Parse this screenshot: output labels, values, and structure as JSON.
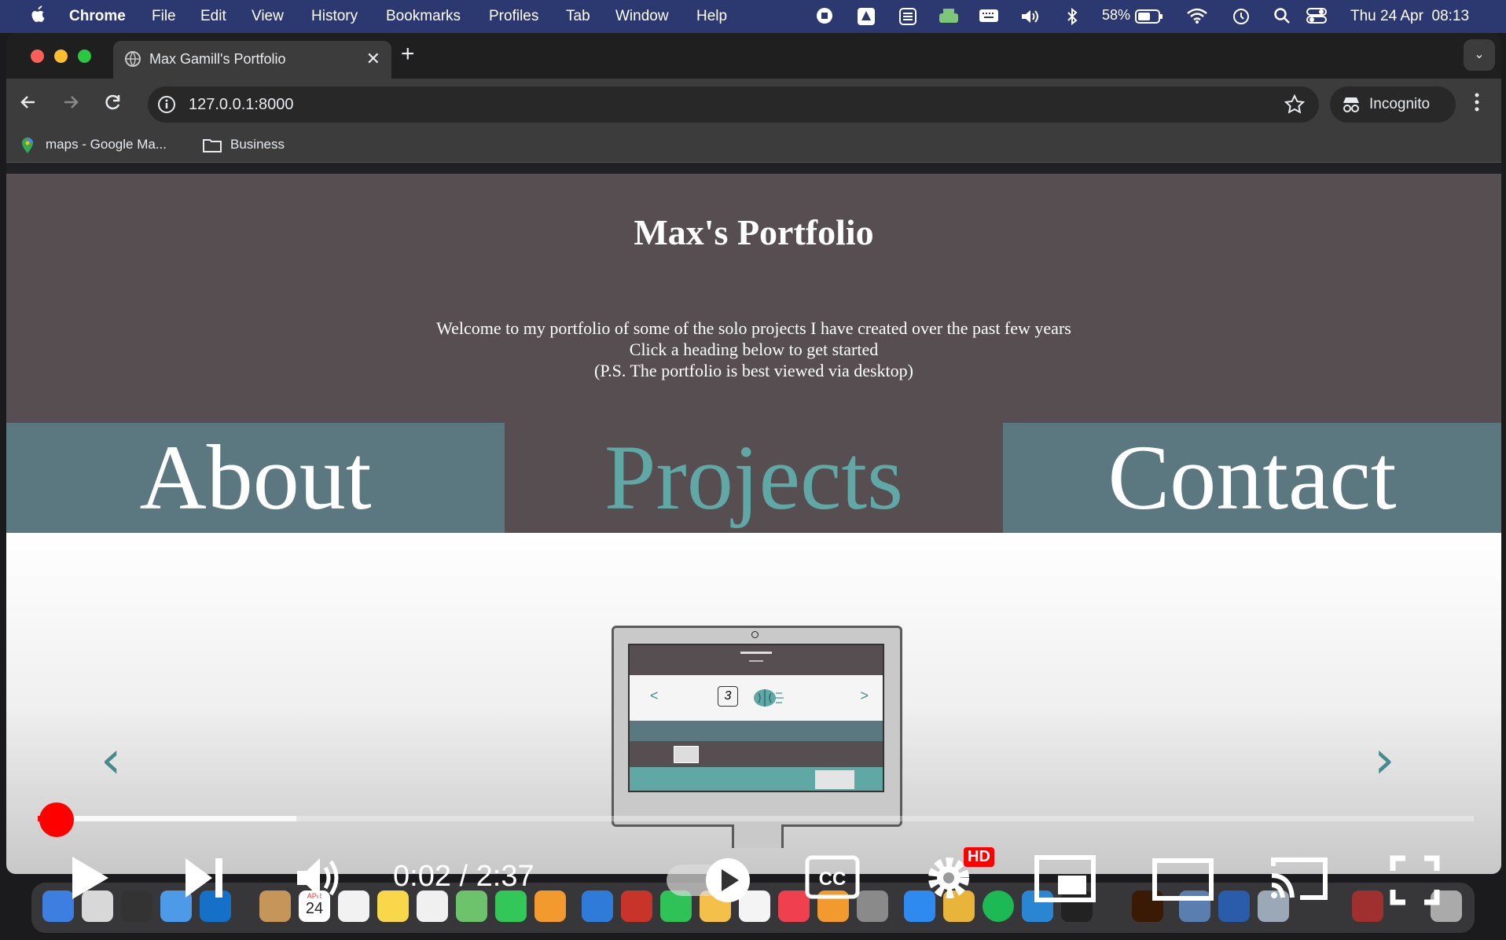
{
  "menubar": {
    "app": "Chrome",
    "items": [
      "File",
      "Edit",
      "View",
      "History",
      "Bookmarks",
      "Profiles",
      "Tab",
      "Window",
      "Help"
    ],
    "battery": "58%",
    "datetime": "Thu 24 Apr  08:13"
  },
  "browser": {
    "tab_title": "Max Gamill's Portfolio",
    "url": "127.0.0.1:8000",
    "profile": "Incognito",
    "bookmarks": [
      "maps - Google Ma...",
      "Business"
    ]
  },
  "page": {
    "title": "Max's Portfolio",
    "intro": [
      "Welcome to my portfolio of some of the solo projects I have created over the past few years",
      "Click a heading below to get started",
      "(P.S. The portfolio is best viewed via desktop)"
    ],
    "nav": [
      "About",
      "Projects",
      "Contact"
    ],
    "carousel_prev": "‹",
    "carousel_next": "›",
    "monitor_counter": "3"
  },
  "video": {
    "time": "0:02 / 2:37",
    "quality_badge": "HD",
    "progress": 0.013,
    "buffered": 0.18
  },
  "dock": {
    "calendar_month": "APR",
    "calendar_day": "24"
  },
  "colors": {
    "menubar": "#2c3870",
    "page_bg": "#564e50",
    "nav_box": "#5b7880",
    "accent_teal": "#5fa8a5",
    "progress_red": "#f00"
  }
}
